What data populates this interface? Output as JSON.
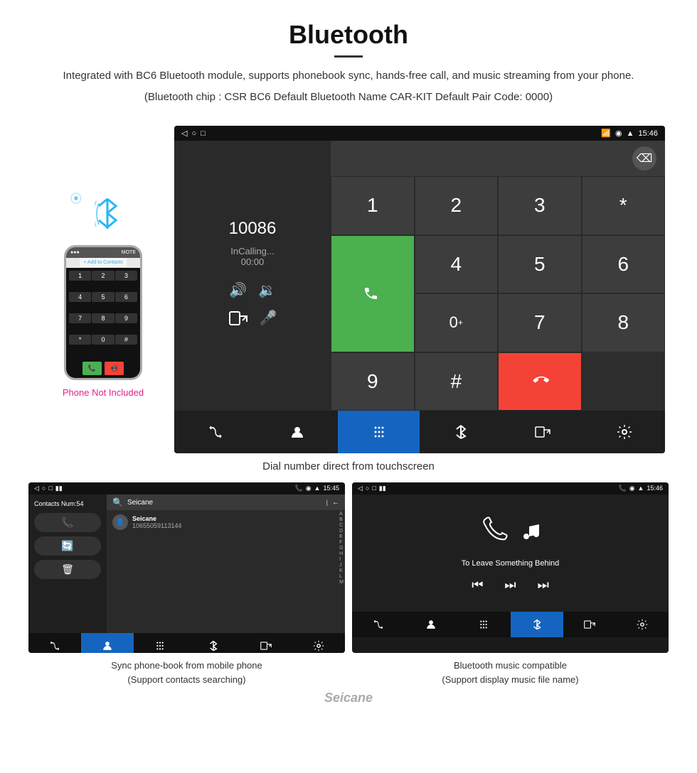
{
  "header": {
    "title": "Bluetooth",
    "description": "Integrated with BC6 Bluetooth module, supports phonebook sync, hands-free call, and music streaming from your phone.",
    "info_line": "(Bluetooth chip : CSR BC6    Default Bluetooth Name CAR-KIT    Default Pair Code: 0000)"
  },
  "phone_graphic": {
    "not_included": "Phone Not Included",
    "add_contacts": "+ Add to Contacts",
    "keys": [
      "1",
      "2",
      "3",
      "4",
      "5",
      "6",
      "7",
      "8",
      "9",
      "*",
      "0",
      "#"
    ]
  },
  "dial_screen": {
    "status_time": "15:46",
    "number": "10086",
    "status": "InCalling...",
    "timer": "00:00",
    "keys": [
      "1",
      "2",
      "3",
      "*",
      "4",
      "5",
      "6",
      "0+",
      "7",
      "8",
      "9",
      "#"
    ]
  },
  "main_caption": "Dial number direct from touchscreen",
  "contacts_screen": {
    "status_time": "15:45",
    "contacts_num": "Contacts Num:54",
    "search_placeholder": "Seicane",
    "phone_number": "10655059113144",
    "alpha_letters": [
      "A",
      "B",
      "C",
      "D",
      "E",
      "F",
      "G",
      "H",
      "I",
      "J",
      "K",
      "L",
      "M"
    ]
  },
  "contacts_caption": {
    "line1": "Sync phone-book from mobile phone",
    "line2": "(Support contacts searching)"
  },
  "music_screen": {
    "status_time": "15:46",
    "song_name": "To Leave Something Behind"
  },
  "music_caption": {
    "line1": "Bluetooth music compatible",
    "line2": "(Support display music file name)"
  },
  "watermark": "Seicane"
}
